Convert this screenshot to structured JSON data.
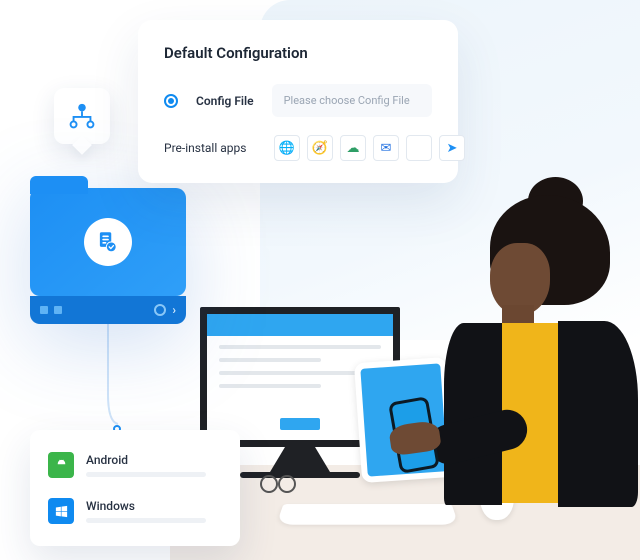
{
  "config_card": {
    "title": "Default Configuration",
    "radio_label": "Config File",
    "file_placeholder": "Please choose Config File",
    "preinstall_label": "Pre-install apps",
    "apps": [
      {
        "name": "globe-app",
        "glyph": "🌐",
        "color": "#14b1a2"
      },
      {
        "name": "browser-app",
        "glyph": "🧭",
        "color": "#1461d1"
      },
      {
        "name": "cloud-app",
        "glyph": "☁",
        "color": "#2e9e66"
      },
      {
        "name": "mail-app",
        "glyph": "✉",
        "color": "#1f6fe0"
      },
      {
        "name": "blank-app",
        "glyph": "",
        "color": "#ffffff"
      },
      {
        "name": "send-app",
        "glyph": "➤",
        "color": "#1d8ff4"
      }
    ]
  },
  "os_list": {
    "android": "Android",
    "windows": "Windows"
  },
  "colors": {
    "accent": "#0f8af0",
    "folder_gradient_from": "#1d8ff4",
    "folder_gradient_to": "#2f9ff8",
    "android": "#3bb54a",
    "windows": "#0f8af0"
  }
}
